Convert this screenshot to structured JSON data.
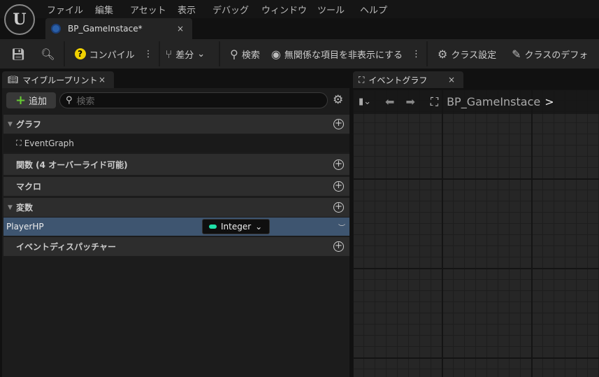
{
  "menu": [
    "ファイル",
    "編集",
    "アセット",
    "表示",
    "デバッグ",
    "ウィンドウ",
    "ツール",
    "ヘルプ"
  ],
  "doc_tab": {
    "title": "BP_GameInstace*",
    "close": "×"
  },
  "toolbar": {
    "compile": "コンパイル",
    "diff": "差分",
    "search": "検索",
    "hide_unrelated": "無関係な項目を非表示にする",
    "class_settings": "クラス設定",
    "class_defaults": "クラスのデフォ"
  },
  "my_blueprint": {
    "tab": "マイブループリント",
    "close": "×",
    "add": "追加",
    "search_placeholder": "検索",
    "sections": {
      "graphs": "グラフ",
      "event_graph": "EventGraph",
      "functions": "関数 (4 オーバーライド可能)",
      "macros": "マクロ",
      "variables": "変数",
      "dispatchers": "イベントディスパッチャー"
    },
    "variable": {
      "name": "PlayerHP",
      "type": "Integer",
      "type_color": "#1fe0a8"
    }
  },
  "graph": {
    "tab": "イベントグラフ",
    "close": "×",
    "breadcrumb": "BP_GameInstace",
    "sep": ">"
  }
}
